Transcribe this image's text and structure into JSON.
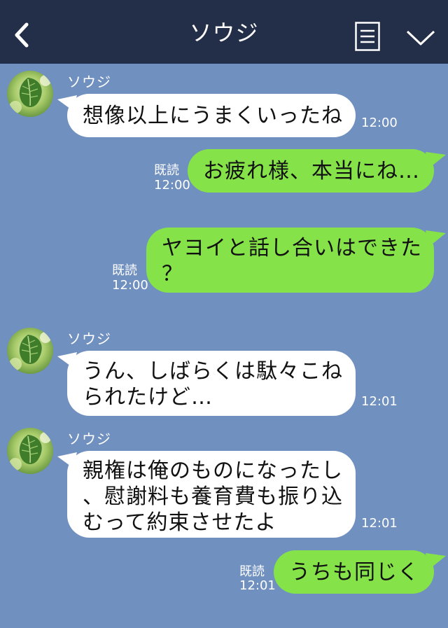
{
  "header": {
    "title": "ソウジ"
  },
  "colors": {
    "header_bg": "#232f48",
    "chat_bg": "#7090c0",
    "incoming_bubble": "#ffffff",
    "outgoing_bubble": "#85e249"
  },
  "icons": {
    "back": "back-chevron-icon",
    "menu": "document-menu-icon",
    "expand": "chevron-down-icon"
  },
  "messages": [
    {
      "direction": "in",
      "sender": "ソウジ",
      "lines": [
        "想像以上にうまくいったね"
      ],
      "time": "12:00"
    },
    {
      "direction": "out",
      "read": "既読",
      "lines": [
        "お疲れ様、本当にね…"
      ],
      "time": "12:00"
    },
    {
      "direction": "out",
      "read": "既読",
      "lines": [
        "ヤヨイと話し合いはできた",
        "？"
      ],
      "time": "12:00"
    },
    {
      "direction": "in",
      "sender": "ソウジ",
      "lines": [
        "うん、しばらくは駄々こね",
        "られたけど…"
      ],
      "time": "12:01"
    },
    {
      "direction": "in",
      "sender": "ソウジ",
      "lines": [
        "親権は俺のものになったし",
        "、慰謝料も養育費も振り込",
        "むって約束させたよ"
      ],
      "time": "12:01"
    },
    {
      "direction": "out",
      "read": "既読",
      "lines": [
        "うちも同じく"
      ],
      "time": "12:01"
    }
  ]
}
